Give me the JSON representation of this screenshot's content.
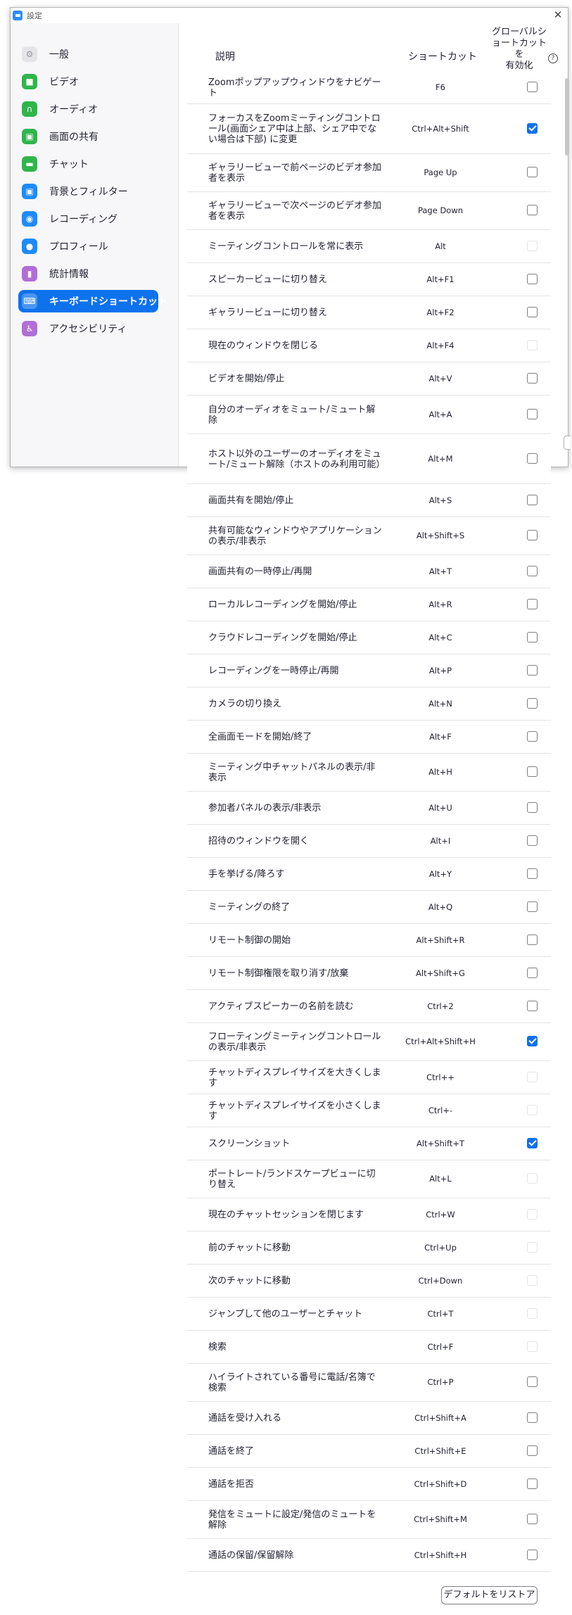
{
  "window": {
    "title": "設定",
    "close_glyph": "✕"
  },
  "sidebar": {
    "items": [
      {
        "label": "一般",
        "icon": "gear-icon",
        "color": "#e4e4e9",
        "glyph": "⚙"
      },
      {
        "label": "ビデオ",
        "icon": "video-icon",
        "color": "#2fb54b",
        "glyph": "■"
      },
      {
        "label": "オーディオ",
        "icon": "headphones-icon",
        "color": "#2fb54b",
        "glyph": "∩"
      },
      {
        "label": "画面の共有",
        "icon": "share-screen-icon",
        "color": "#2fb54b",
        "glyph": "▣"
      },
      {
        "label": "チャット",
        "icon": "chat-icon",
        "color": "#2fb54b",
        "glyph": "▬"
      },
      {
        "label": "背景とフィルター",
        "icon": "background-icon",
        "color": "#1d8bff",
        "glyph": "▣"
      },
      {
        "label": "レコーディング",
        "icon": "recording-icon",
        "color": "#1d8bff",
        "glyph": "◉"
      },
      {
        "label": "プロフィール",
        "icon": "profile-icon",
        "color": "#1d8bff",
        "glyph": "●"
      },
      {
        "label": "統計情報",
        "icon": "statistics-icon",
        "color": "#b16ed6",
        "glyph": "▮"
      },
      {
        "label": "キーボードショートカット",
        "icon": "keyboard-icon",
        "color": "#1d8bff",
        "glyph": "⌨",
        "active": true
      },
      {
        "label": "アクセシビリティ",
        "icon": "accessibility-icon",
        "color": "#b16ed6",
        "glyph": "♿"
      }
    ]
  },
  "header": {
    "description": "説明",
    "shortcut": "ショートカット",
    "global_line1": "グローバルシ",
    "global_line2": "ョートカットを",
    "global_line3": "有効化",
    "help_glyph": "?"
  },
  "shortcuts": [
    {
      "desc": "Zoomポップアップウィンドウをナビゲート",
      "key": "F6",
      "state": "unchecked"
    },
    {
      "desc": "フォーカスをZoomミーティングコントロール(画面シェア中は上部、シェア中でない場合は下部) に変更",
      "key": "Ctrl+Alt+Shift",
      "state": "checked"
    },
    {
      "desc": "ギャラリービューで前ページのビデオ参加者を表示",
      "key": "Page Up",
      "state": "unchecked"
    },
    {
      "desc": "ギャラリービューで次ページのビデオ参加者を表示",
      "key": "Page Down",
      "state": "unchecked"
    },
    {
      "desc": "ミーティングコントロールを常に表示",
      "key": "Alt",
      "state": "disabled"
    },
    {
      "desc": "スピーカービューに切り替え",
      "key": "Alt+F1",
      "state": "unchecked"
    },
    {
      "desc": "ギャラリービューに切り替え",
      "key": "Alt+F2",
      "state": "unchecked"
    },
    {
      "desc": "現在のウィンドウを閉じる",
      "key": "Alt+F4",
      "state": "disabled"
    },
    {
      "desc": "ビデオを開始/停止",
      "key": "Alt+V",
      "state": "unchecked"
    },
    {
      "desc": "自分のオーディオをミュート/ミュート解除",
      "key": "Alt+A",
      "state": "unchecked"
    },
    {
      "desc": "ホスト以外のユーザーのオーディオをミュート/ミュート解除（ホストのみ利用可能）",
      "key": "Alt+M",
      "state": "unchecked"
    },
    {
      "desc": "画面共有を開始/停止",
      "key": "Alt+S",
      "state": "unchecked"
    },
    {
      "desc": "共有可能なウィンドウやアプリケーションの表示/非表示",
      "key": "Alt+Shift+S",
      "state": "unchecked"
    },
    {
      "desc": "画面共有の一時停止/再開",
      "key": "Alt+T",
      "state": "unchecked"
    },
    {
      "desc": "ローカルレコーディングを開始/停止",
      "key": "Alt+R",
      "state": "unchecked"
    },
    {
      "desc": "クラウドレコーディングを開始/停止",
      "key": "Alt+C",
      "state": "unchecked"
    },
    {
      "desc": "レコーディングを一時停止/再開",
      "key": "Alt+P",
      "state": "unchecked"
    },
    {
      "desc": "カメラの切り換え",
      "key": "Alt+N",
      "state": "unchecked"
    },
    {
      "desc": "全画面モードを開始/終了",
      "key": "Alt+F",
      "state": "unchecked"
    },
    {
      "desc": "ミーティング中チャットパネルの表示/非表示",
      "key": "Alt+H",
      "state": "unchecked"
    },
    {
      "desc": "参加者パネルの表示/非表示",
      "key": "Alt+U",
      "state": "unchecked"
    },
    {
      "desc": "招待のウィンドウを開く",
      "key": "Alt+I",
      "state": "unchecked"
    },
    {
      "desc": "手を挙げる/降ろす",
      "key": "Alt+Y",
      "state": "unchecked"
    },
    {
      "desc": "ミーティングの終了",
      "key": "Alt+Q",
      "state": "unchecked"
    },
    {
      "desc": "リモート制御の開始",
      "key": "Alt+Shift+R",
      "state": "unchecked"
    },
    {
      "desc": "リモート制御権限を取り消す/放棄",
      "key": "Alt+Shift+G",
      "state": "unchecked"
    },
    {
      "desc": "アクティブスピーカーの名前を読む",
      "key": "Ctrl+2",
      "state": "unchecked"
    },
    {
      "desc": "フローティングミーティングコントロールの表示/非表示",
      "key": "Ctrl+Alt+Shift+H",
      "state": "checked"
    },
    {
      "desc": "チャットディスプレイサイズを大きくします",
      "key": "Ctrl++",
      "state": "disabled"
    },
    {
      "desc": "チャットディスプレイサイズを小さくします",
      "key": "Ctrl+-",
      "state": "disabled"
    },
    {
      "desc": "スクリーンショット",
      "key": "Alt+Shift+T",
      "state": "checked"
    },
    {
      "desc": "ポートレート/ランドスケープビューに切り替え",
      "key": "Alt+L",
      "state": "disabled"
    },
    {
      "desc": "現在のチャットセッションを閉じます",
      "key": "Ctrl+W",
      "state": "disabled"
    },
    {
      "desc": "前のチャットに移動",
      "key": "Ctrl+Up",
      "state": "disabled"
    },
    {
      "desc": "次のチャットに移動",
      "key": "Ctrl+Down",
      "state": "disabled"
    },
    {
      "desc": "ジャンプして他のユーザーとチャット",
      "key": "Ctrl+T",
      "state": "disabled"
    },
    {
      "desc": "検索",
      "key": "Ctrl+F",
      "state": "disabled"
    },
    {
      "desc": "ハイライトされている番号に電話/名簿で検索",
      "key": "Ctrl+P",
      "state": "unchecked"
    },
    {
      "desc": "通話を受け入れる",
      "key": "Ctrl+Shift+A",
      "state": "unchecked"
    },
    {
      "desc": "通話を終了",
      "key": "Ctrl+Shift+E",
      "state": "unchecked"
    },
    {
      "desc": "通話を拒否",
      "key": "Ctrl+Shift+D",
      "state": "unchecked"
    },
    {
      "desc": "発信をミュートに設定/発信のミュートを解除",
      "key": "Ctrl+Shift+M",
      "state": "unchecked"
    },
    {
      "desc": "通話の保留/保留解除",
      "key": "Ctrl+Shift+H",
      "state": "unchecked"
    }
  ],
  "footer": {
    "restore_label": "デフォルトをリストア"
  }
}
